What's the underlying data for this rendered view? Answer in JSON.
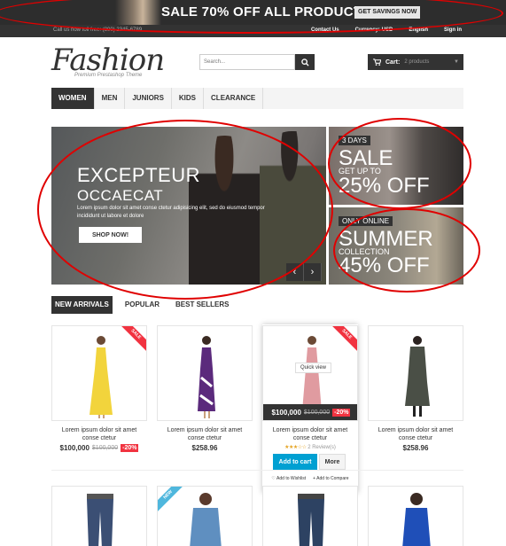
{
  "promo": {
    "text": "SALE 70% OFF ALL PRODUCTS",
    "button": "GET SAVINGS NOW"
  },
  "topbar": {
    "call": "Call us now toll free: (800) 2345-6789",
    "links": [
      "Contact Us",
      "Currency: USD",
      "English",
      "Sign in"
    ]
  },
  "logo": {
    "title": "Fashion",
    "tagline": "Premium Prestashop Theme"
  },
  "search": {
    "placeholder": "Search..."
  },
  "cart": {
    "label": "Cart:",
    "count": "2 products"
  },
  "nav": [
    "WOMEN",
    "MEN",
    "JUNIORS",
    "KIDS",
    "CLEARANCE"
  ],
  "hero": {
    "line1": "EXCEPTEUR",
    "line2": "OCCAECAT",
    "body": "Lorem ipsum dolor sit amet conse ctetur adipisicing elit, sed do eiusmod tempor incididunt ut labore et dolore",
    "button": "SHOP NOW!",
    "prev": "‹",
    "next": "›"
  },
  "banner1": {
    "pill": "3 DAYS",
    "big": "SALE",
    "sub": "GET UP TO",
    "pct": "25% OFF"
  },
  "banner2": {
    "pill": "ONLY ONLINE",
    "big": "SUMMER",
    "sub": "COLLECTION",
    "pct": "45% OFF"
  },
  "tabs": [
    "NEW ARRIVALS",
    "POPULAR",
    "BEST SELLERS"
  ],
  "products": [
    {
      "name": "Lorem ipsum dolor sit amet conse ctetur",
      "price": "$100,000",
      "old": "$100,000",
      "discount": "-20%",
      "ribbon": "SALE",
      "color": "#f2d43c"
    },
    {
      "name": "Lorem ipsum dolor sit amet conse ctetur",
      "price": "$258.96",
      "color": "#5b2a7c"
    },
    {
      "name": "Lorem ipsum dolor sit amet conse ctetur",
      "price": "$100,000",
      "old": "$100,000",
      "discount": "-20%",
      "ribbon": "SALE",
      "color": "#e09ba0",
      "quick": "Quick view",
      "reviews": "2 Review(s)",
      "stars": "★★★☆☆",
      "add": "Add to cart",
      "more": "More",
      "wish": "Add to Wishlist",
      "compare": "Add to Compare"
    },
    {
      "name": "Lorem ipsum dolor sit amet conse ctetur",
      "price": "$258.96",
      "color": "#4a4f46"
    }
  ],
  "row2ribbon": "NEW"
}
